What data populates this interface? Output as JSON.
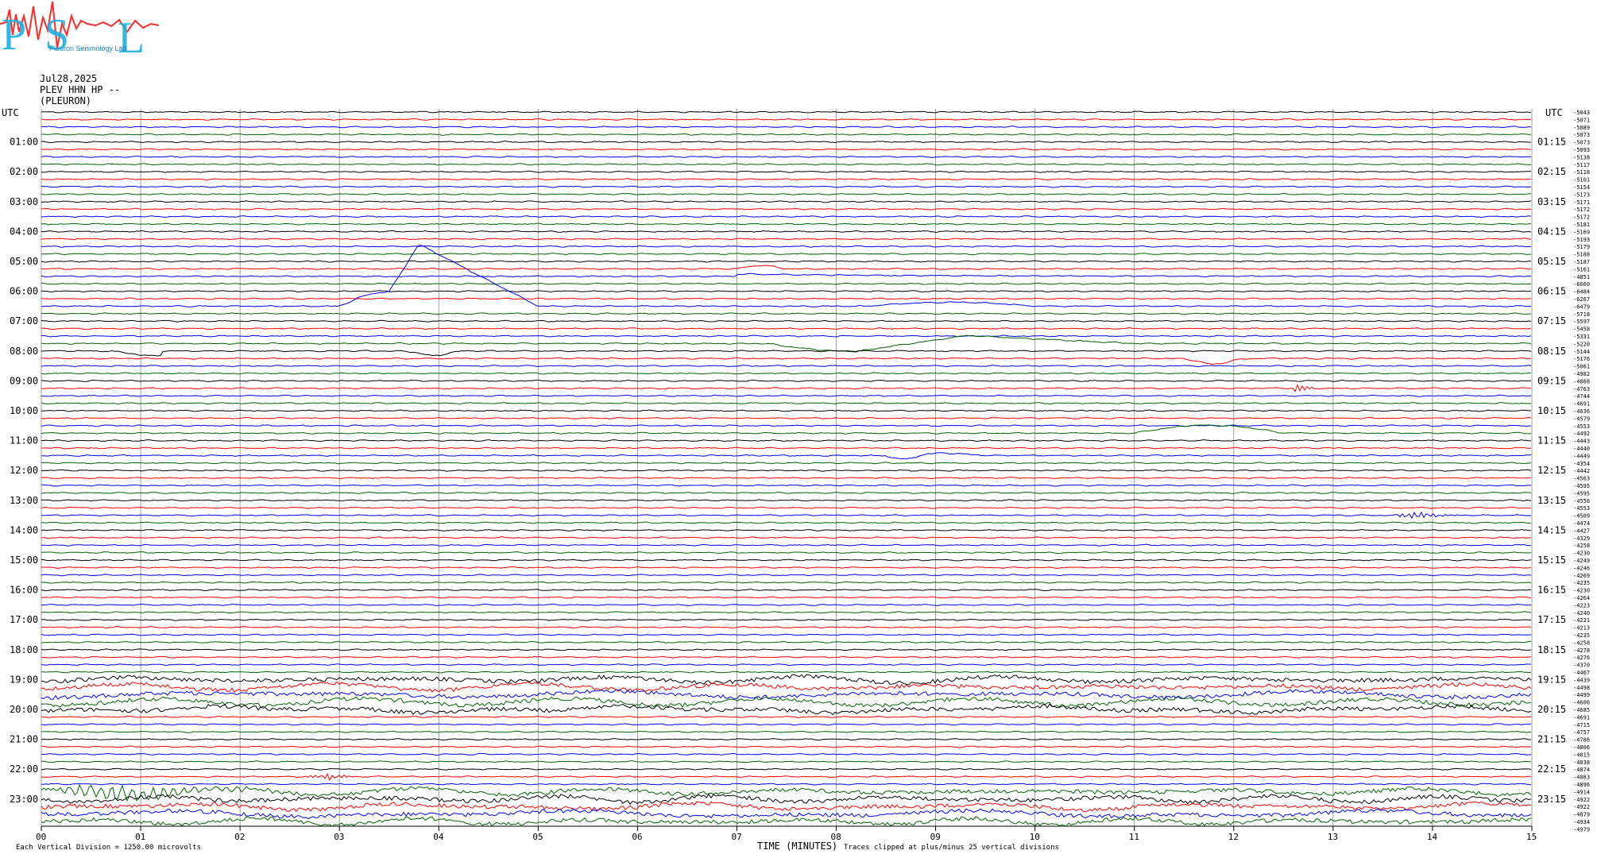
{
  "header": {
    "date": "Jul28,2025",
    "station": "PLEV HHN HP --",
    "place": "(PLEURON)",
    "logo_letters": [
      "P",
      "S",
      "L"
    ],
    "logo_words": "Pleuron Seismology Lab"
  },
  "axis": {
    "left_label": "UTC",
    "right_label": "UTC",
    "left_hours": [
      "01:00",
      "02:00",
      "03:00",
      "04:00",
      "05:00",
      "06:00",
      "07:00",
      "08:00",
      "09:00",
      "10:00",
      "11:00",
      "12:00",
      "13:00",
      "14:00",
      "15:00",
      "16:00",
      "17:00",
      "18:00",
      "19:00",
      "20:00",
      "21:00",
      "22:00",
      "23:00"
    ],
    "right_hours": [
      "01:15",
      "02:15",
      "03:15",
      "04:15",
      "05:15",
      "06:15",
      "07:15",
      "08:15",
      "09:15",
      "10:15",
      "11:15",
      "12:15",
      "13:15",
      "14:15",
      "15:15",
      "16:15",
      "17:15",
      "18:15",
      "19:15",
      "20:15",
      "21:15",
      "22:15",
      "23:15"
    ],
    "x_ticks": [
      "00",
      "01",
      "02",
      "03",
      "04",
      "05",
      "06",
      "07",
      "08",
      "09",
      "10",
      "11",
      "12",
      "13",
      "14",
      "15"
    ],
    "xlabel": "TIME (MINUTES)",
    "clip_note": "Traces clipped at plus/minus 25 vertical divisions",
    "scale_note": "Each Vertical Division = 1250.00 microvolts"
  },
  "chart_data": {
    "type": "line",
    "title": "",
    "xlabel": "TIME (MINUTES)",
    "ylabel": "UTC",
    "xlim": [
      0,
      15
    ],
    "rows": 96,
    "minutes_per_row": 15,
    "trace_colors": [
      "#000000",
      "#ff0000",
      "#0000ff",
      "#006400"
    ],
    "offsets": [
      -5043,
      -5071,
      -5089,
      -5073,
      -5073,
      -5093,
      -5138,
      -5117,
      -5118,
      -5101,
      -5154,
      -5173,
      -5171,
      -5172,
      -5172,
      -5181,
      -5169,
      -5193,
      -5179,
      -5188,
      -5187,
      -5161,
      -4851,
      -6660,
      -6484,
      -6267,
      -6479,
      -5718,
      -5597,
      -5458,
      -5331,
      -5220,
      -5144,
      -5176,
      -5061,
      -4982,
      -4868,
      -4763,
      -4744,
      -4691,
      -4636,
      -4579,
      -4553,
      -4492,
      -4443,
      -4440,
      -4449,
      -4354,
      -4442,
      -4563,
      -4595,
      -4595,
      -4556,
      -4553,
      -4509,
      -4474,
      -4427,
      -4329,
      -4258,
      -4230,
      -4249,
      -4246,
      -4269,
      -4235,
      -4230,
      -4264,
      -4223,
      -4240,
      -4221,
      -4213,
      -4235,
      -4258,
      -4278,
      -4276,
      -4370,
      -4467,
      -4439,
      -4498,
      -4499,
      -4606,
      -4685,
      -4691,
      -4715,
      -4757,
      -4786,
      -4806,
      -4815,
      -4838,
      -4874,
      -4883,
      -4896,
      -4914,
      -4922,
      -4922,
      -4879,
      -4934,
      -4979
    ]
  }
}
